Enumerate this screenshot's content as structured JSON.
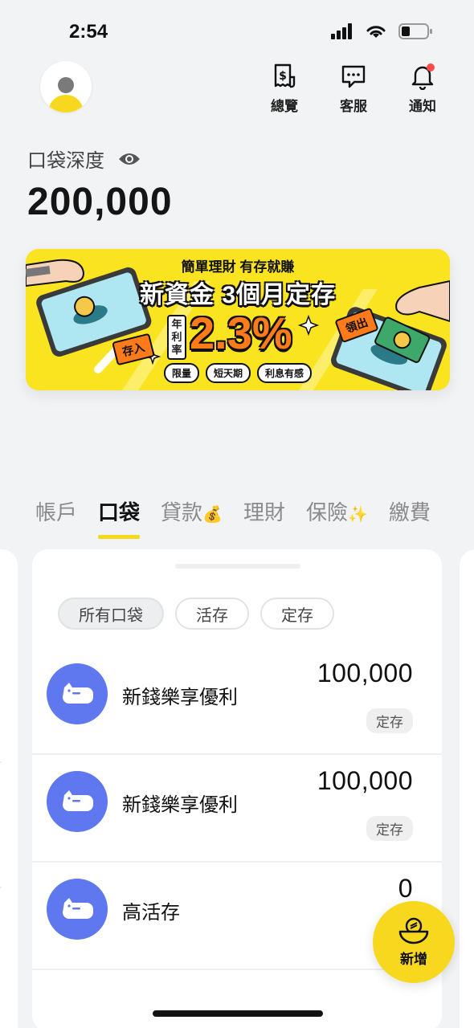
{
  "status_bar": {
    "time": "2:54"
  },
  "header": {
    "actions": [
      {
        "label": "總覽",
        "icon": "receipt-dollar-icon"
      },
      {
        "label": "客服",
        "icon": "chat-bubble-icon"
      },
      {
        "label": "通知",
        "icon": "bell-icon"
      }
    ]
  },
  "balance": {
    "label": "口袋深度",
    "amount": "200,000"
  },
  "banner": {
    "title1": "簡單理財 有存就賺",
    "title2": "新資金 3個月定存",
    "rate_label": "年利率",
    "rate": "2.3%",
    "chips": [
      "限量",
      "短天期",
      "利息有感"
    ],
    "tag_in": "存入",
    "tag_out": "領出"
  },
  "tabs": [
    {
      "label": "帳戶",
      "emoji": ""
    },
    {
      "label": "口袋",
      "emoji": ""
    },
    {
      "label": "貸款",
      "emoji": "💰"
    },
    {
      "label": "理財",
      "emoji": ""
    },
    {
      "label": "保險",
      "emoji": "✨"
    },
    {
      "label": "繳費",
      "emoji": ""
    }
  ],
  "active_tab": "口袋",
  "filters": [
    "所有口袋",
    "活存",
    "定存"
  ],
  "active_filter": "所有口袋",
  "pockets": [
    {
      "name": "新錢樂享優利",
      "amount": "100,000",
      "type": "定存"
    },
    {
      "name": "新錢樂享優利",
      "amount": "100,000",
      "type": "定存"
    },
    {
      "name": "高活存",
      "amount": "0",
      "type": ""
    }
  ],
  "fab": {
    "label": "新增",
    "icon": "coin-pot-icon"
  },
  "colors": {
    "accent": "#f7d81e",
    "pocket_icon_bg": "#6078ef",
    "notification_dot": "#ff4a4a"
  }
}
